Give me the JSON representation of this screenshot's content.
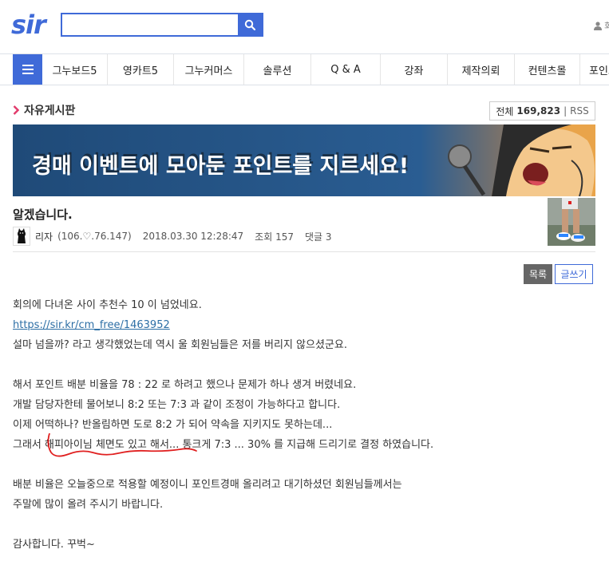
{
  "header": {
    "logo_text": "sir",
    "search": {
      "value": "",
      "placeholder": ""
    },
    "user_icon": "user-icon",
    "user_text": "회"
  },
  "nav": {
    "menu_icon": "hamburger-icon",
    "items": [
      "그누보드5",
      "영카트5",
      "그누커머스",
      "솔루션",
      "Q & A",
      "강좌",
      "제작의뢰",
      "컨텐츠몰",
      "포인트"
    ]
  },
  "board": {
    "title": "자유게시판",
    "total_label": "전체",
    "total_count": "169,823",
    "separator": "|",
    "rss_label": "RSS"
  },
  "banner": {
    "text": "경매 이벤트에 모아둔 포인트를 지르세요!"
  },
  "post": {
    "title": "알겠습니다.",
    "author": "리자",
    "ip": "(106.♡.76.147)",
    "datetime": "2018.03.30 12:28:47",
    "views": "조회 157",
    "comments": "댓글 3"
  },
  "buttons": {
    "list": "목록",
    "write": "글쓰기"
  },
  "body": {
    "line1": "회의에 다녀온 사이 추천수 10 이 넘었네요.",
    "link": "https://sir.kr/cm_free/1463952",
    "line3": "설마 넘을까? 라고 생각했었는데 역시 울 회원님들은 저를 버리지 않으셨군요.",
    "line4": "해서 포인트 배분 비율을 78 : 22 로 하려고 했으나 문제가 하나 생겨 버렸네요.",
    "line5": "개발 담당자한테 물어보니 8:2 또는 7:3 과 같이 조정이 가능하다고 합니다.",
    "line6": "이제 어떡하나? 반올림하면 도로 8:2 가 되어 약속을 지키지도 못하는데...",
    "line7": "그래서 해피아이님 체면도 있고 해서... 통크게 7:3 ... 30% 를 지급해 드리기로 결정 하였습니다.",
    "line8": "배분 비율은 오늘중으로 적용할 예정이니 포인트경매 올리려고 대기하셨던 회원님들께서는",
    "line9": "주말에 많이 올려 주시기 바랍니다.",
    "line10": "감사합니다. 꾸벅~"
  },
  "colors": {
    "brand_blue": "#3f6ad8",
    "banner_bg": "#23527d",
    "accent_pink": "#e23a6b",
    "annotation_red": "#e02020"
  }
}
